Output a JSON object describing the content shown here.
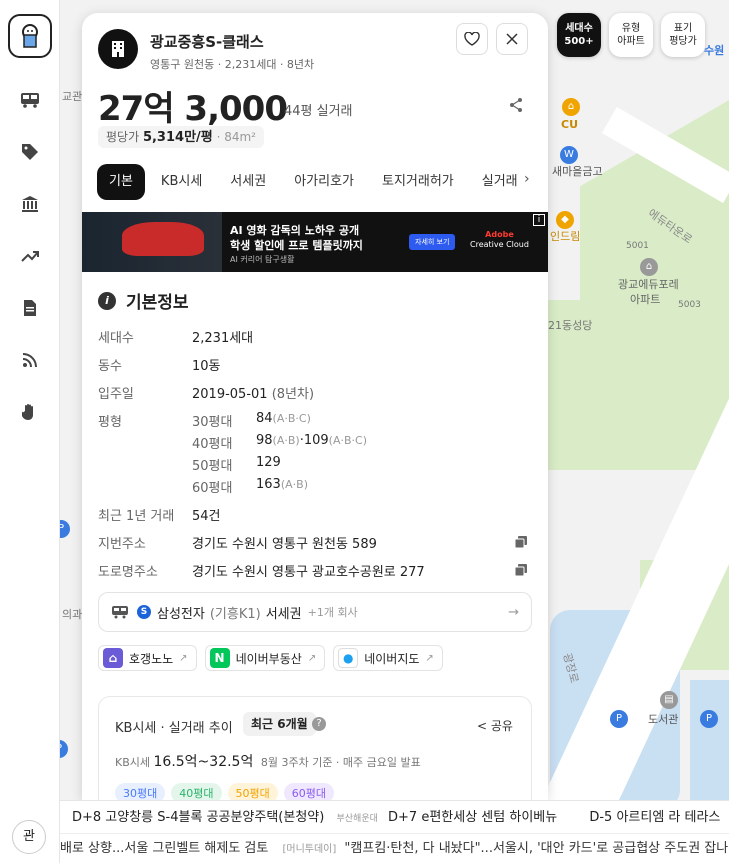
{
  "map": {
    "labels": [
      "CU",
      "새마을금고",
      "에듀타운로",
      "인드림",
      "5001",
      "광교에듀포레",
      "아파트",
      "5003",
      "21동성당",
      "도서관",
      "광장로",
      "교관",
      "의과"
    ],
    "top_buttons": [
      {
        "line1": "세대수",
        "line2": "500+"
      },
      {
        "line1": "유형",
        "line2": "아파트"
      },
      {
        "line1": "표기",
        "line2": "평당가"
      }
    ],
    "station": "수원"
  },
  "rail": {
    "bottom_label": "관"
  },
  "apt": {
    "name": "광교중흥S-클래스",
    "sub": "영통구 원천동 · 2,231세대 · 8년차",
    "price": "27억 3,000",
    "price_sub": "44평 실거래",
    "unit_label": "평당가",
    "unit_price": "5,314만/평",
    "unit_area": "· 84m²"
  },
  "tabs": [
    "기본",
    "KB시세",
    "서세권",
    "아가리호가",
    "토지거래허가",
    "실거래"
  ],
  "ad": {
    "line1": "AI 영화 감독의 노하우 공개",
    "line2": "학생 할인에 프로 템플릿까지",
    "line3": "AI 커리어 탐구생활",
    "cta": "자세히 보기",
    "brand1": "Adobe",
    "brand2": "Creative Cloud"
  },
  "basic": {
    "title": "기본정보",
    "households_k": "세대수",
    "households_v": "2,231세대",
    "buildings_k": "동수",
    "buildings_v": "10동",
    "movein_k": "입주일",
    "movein_v": "2019-05-01",
    "movein_dim": "(8년차)",
    "pyeong_k": "평형",
    "pyeong": [
      {
        "t": "30평대",
        "v": "84",
        "d": "(A·B·C)",
        "v2": "",
        "d2": ""
      },
      {
        "t": "40평대",
        "v": "98",
        "d": "(A·B)",
        "v2": "·109",
        "d2": "(A·B·C)"
      },
      {
        "t": "50평대",
        "v": "129",
        "d": "",
        "v2": "",
        "d2": ""
      },
      {
        "t": "60평대",
        "v": "163",
        "d": "(A·B)",
        "v2": "",
        "d2": ""
      }
    ],
    "trades_k": "최근 1년 거래",
    "trades_v": "54건",
    "jibun_k": "지번주소",
    "jibun_v": "경기도 수원시 영통구 원천동 589",
    "road_k": "도로명주소",
    "road_v": "경기도 수원시 영통구 광교호수공원로 277"
  },
  "commute": {
    "company": "삼성전자",
    "site": "(기흥K1)",
    "zone": "서세권",
    "more": "+1개 회사"
  },
  "links": [
    {
      "label": "호갱노노"
    },
    {
      "label": "네이버부동산"
    },
    {
      "label": "네이버지도"
    }
  ],
  "kb": {
    "title": "KB시세 · 실거래 추이",
    "period": "최근 6개월",
    "share": "공유",
    "range_label": "KB시세",
    "range": "16.5억~32.5억",
    "basis": "8월 3주차 기준 · 매주 금요일 발표",
    "chips": [
      "30평대",
      "40평대",
      "50평대",
      "60평대"
    ]
  },
  "ticker1": {
    "a": "D+8 고양창릉 S-4블록 공공분양주택(본청약)",
    "src": "부산해운대",
    "b": "D+7 e편한세상 센텀 하이베뉴",
    "c": "D-5 아르티엠 라 테라스"
  },
  "ticker2": {
    "a": "배로 상향...서울 그린벨트 해제도 검토",
    "src": "[머니투데이]",
    "b": "\"캠프킴·탄천, 다 내놨다\"...서울시, '대안 카드'로 공급협상 주도권 잡나"
  },
  "colors": {
    "park": "#d9ecc7",
    "water": "#c9dff2",
    "chip30": "#4a7bf7",
    "chip40": "#2bb36a",
    "chip50": "#f0a400",
    "chip60": "#8a5cf0"
  }
}
